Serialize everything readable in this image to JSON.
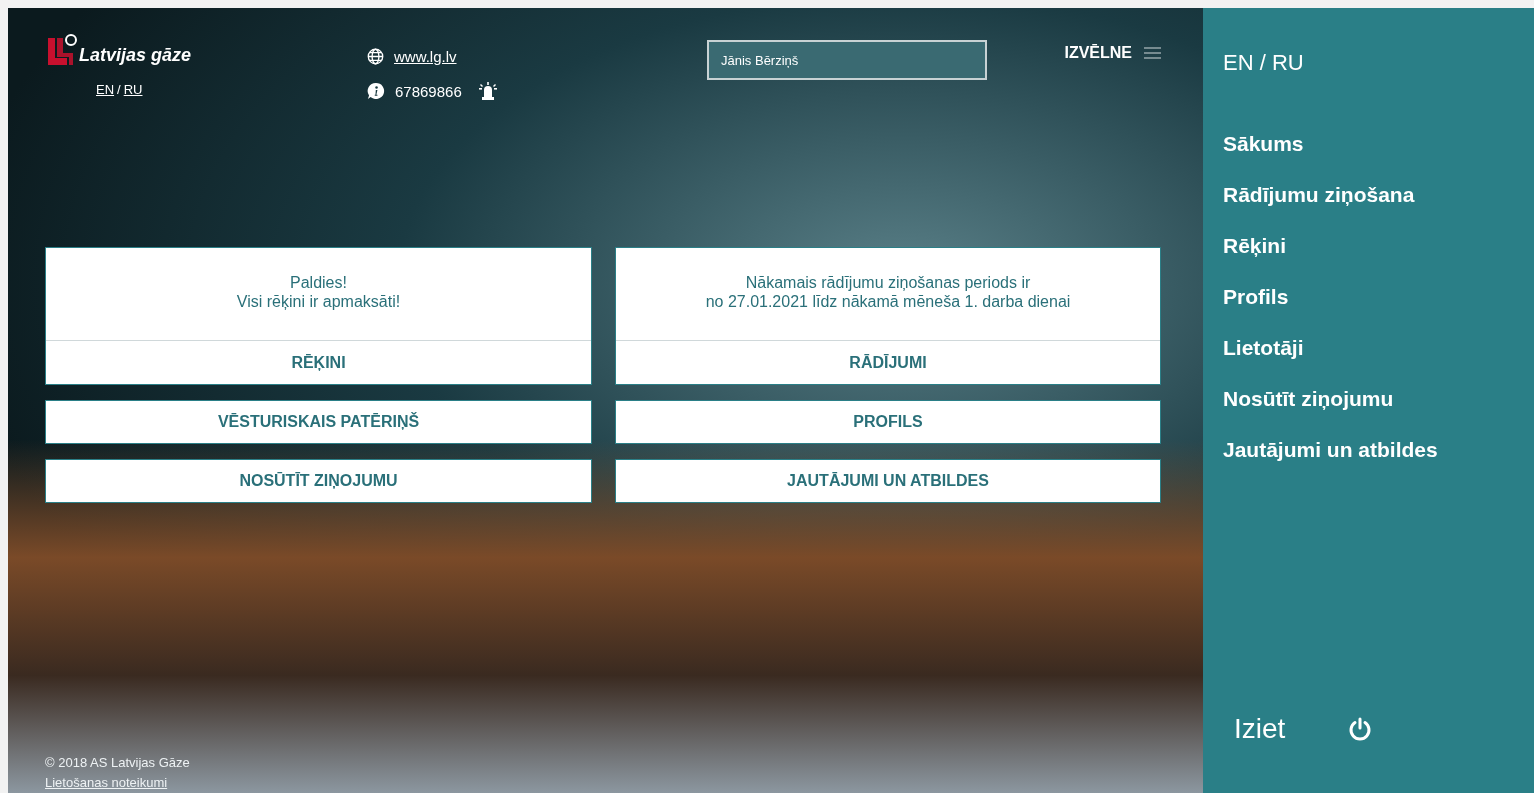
{
  "header": {
    "logo_text": "Latvijas gāze",
    "languages": [
      "EN",
      "RU"
    ],
    "language_separator": "/",
    "website": "www.lg.lv",
    "phone": "67869866",
    "user_field": {
      "value": "Jānis Bērziņš"
    },
    "menu_label": "IZVĒLNE"
  },
  "cards": [
    {
      "message": [
        "Paldies!",
        "Visi rēķini ir apmaksāti!"
      ],
      "button": "RĒĶINI"
    },
    {
      "message": [
        "Nākamais rādījumu ziņošanas periods ir",
        "no 27.01.2021 līdz nākamā mēneša 1. darba dienai"
      ],
      "button": "RĀDĪJUMI"
    }
  ],
  "buttons": [
    "VĒSTURISKAIS PATĒRIŅŠ",
    "PROFILS",
    "NOSŪTĪT ZIŅOJUMU",
    "JAUTĀJUMI UN ATBILDES"
  ],
  "footer": {
    "copyright": "© 2018 AS Latvijas Gāze",
    "terms_link": "Lietošanas noteikumi"
  },
  "sidebar": {
    "languages": "EN / RU",
    "items": [
      "Sākums",
      "Rādījumu ziņošana",
      "Rēķini",
      "Profils",
      "Lietotāji",
      "Nosūtīt ziņojumu",
      "Jautājumi un atbildes"
    ],
    "logout": "Iziet"
  }
}
